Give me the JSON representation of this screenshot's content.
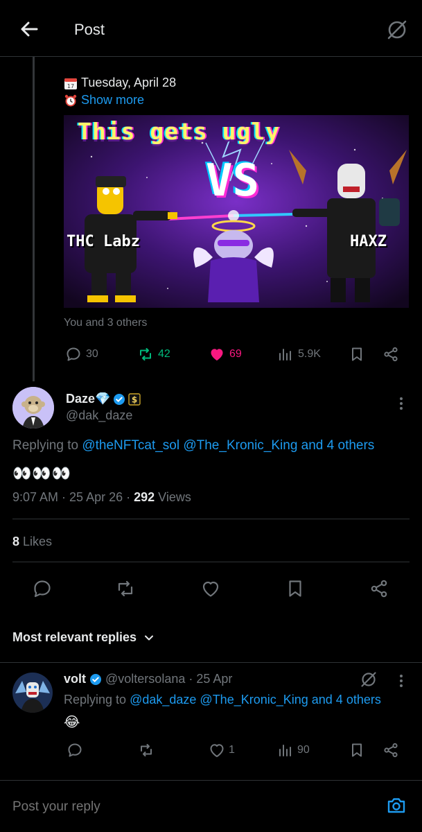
{
  "header": {
    "title": "Post"
  },
  "parent_post": {
    "date_line": "Tuesday, April 28",
    "show_more": "Show more",
    "media": {
      "headline": "This gets ugly",
      "vs": "VS",
      "left_label": "THC Labz",
      "right_label": "HAXZ"
    },
    "liked_by": "You and 3 others",
    "stats": {
      "replies": "30",
      "reposts": "42",
      "likes": "69",
      "views": "5.9K"
    }
  },
  "reply": {
    "author_name": "Daze💎",
    "author_handle": "@dak_daze",
    "replying_prefix": "Replying to",
    "replying_mentions": "@theNFTcat_sol @The_Kronic_King and 4 others",
    "body": "👀👀👀",
    "timestamp": "9:07 AM · 25 Apr 26 · ",
    "views_count": "292",
    "views_label": " Views",
    "likes_count": "8",
    "likes_label": " Likes"
  },
  "replies_section": {
    "sort_label": "Most relevant replies"
  },
  "reply2": {
    "author_name": "volt",
    "author_handle": "@voltersolana",
    "date": "· 25 Apr",
    "replying_prefix": "Replying to",
    "replying_mentions": "@dak_daze @The_Kronic_King and 4 others",
    "body": "😂",
    "stats": {
      "likes": "1",
      "views": "90"
    }
  },
  "compose": {
    "placeholder": "Post your reply"
  },
  "colors": {
    "accent": "#1d9bf0",
    "repost": "#00ba7c",
    "like": "#f91880",
    "muted": "#71767b"
  }
}
